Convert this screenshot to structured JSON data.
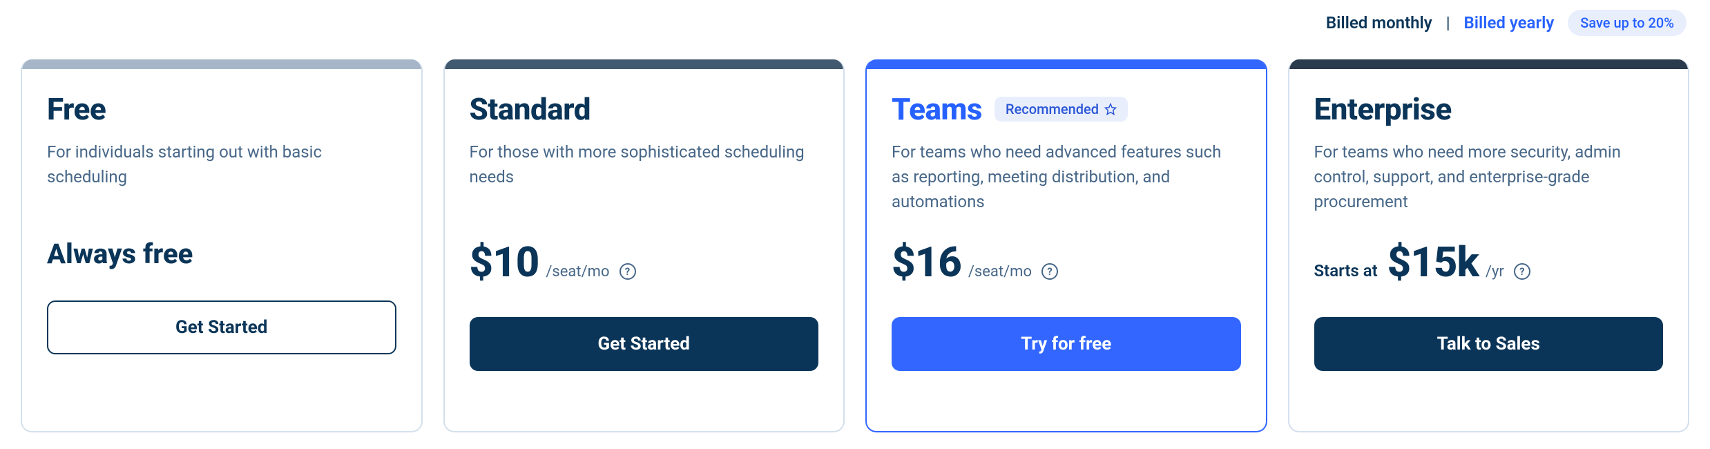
{
  "billing": {
    "monthly": "Billed monthly",
    "yearly": "Billed yearly",
    "save": "Save up to 20%",
    "separator": "|"
  },
  "plans": [
    {
      "key": "free",
      "title": "Free",
      "desc": "For individuals starting out with basic scheduling",
      "recommended": false,
      "price_label": "Always free",
      "starts_at": null,
      "price": null,
      "per": null,
      "has_info": false,
      "cta": "Get Started",
      "cta_style": "outline"
    },
    {
      "key": "standard",
      "title": "Standard",
      "desc": "For those with more sophisticated scheduling needs",
      "recommended": false,
      "price_label": null,
      "starts_at": null,
      "price": "$10",
      "per": "/seat/mo",
      "has_info": true,
      "cta": "Get Started",
      "cta_style": "dark"
    },
    {
      "key": "teams",
      "title": "Teams",
      "desc": "For teams who need advanced features such as reporting, meeting distribution, and automations",
      "recommended": true,
      "recommended_label": "Recommended",
      "price_label": null,
      "starts_at": null,
      "price": "$16",
      "per": "/seat/mo",
      "has_info": true,
      "cta": "Try for free",
      "cta_style": "blue"
    },
    {
      "key": "enterprise",
      "title": "Enterprise",
      "desc": "For teams who need more security, admin control, support, and enterprise-grade procurement",
      "recommended": false,
      "price_label": null,
      "starts_at": "Starts at",
      "price": "$15k",
      "per": "/yr",
      "has_info": true,
      "cta": "Talk to Sales",
      "cta_style": "dark"
    }
  ]
}
